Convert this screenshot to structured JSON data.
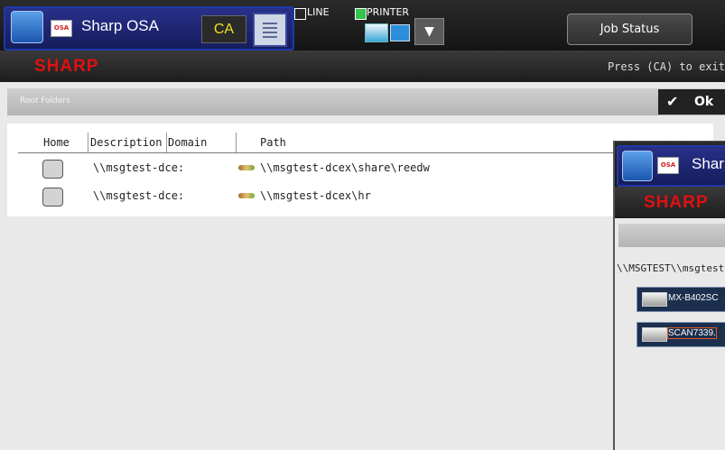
{
  "app": {
    "title": "Sharp OSA",
    "osa_logo_text": "OSA",
    "home_icon": "home-refresh-icon",
    "ca_label": "CA",
    "keypad_icon": "keypad-icon"
  },
  "status": {
    "line_label": "LINE",
    "line_checked": false,
    "printer_label": "PRINTER",
    "printer_checked": true,
    "dropdown_icon": "chevron-down-icon"
  },
  "job_status_label": "Job Status",
  "header": {
    "brand": "SHARP",
    "exit_hint": "Press (CA) to exit"
  },
  "toolbar": {
    "section_label": "Root Folders",
    "ok_label": "Ok",
    "ok_icon": "check-icon"
  },
  "table": {
    "columns": [
      "Home",
      "Description",
      "Domain",
      "Path"
    ],
    "rows": [
      {
        "description": "\\\\msgtest-dce:",
        "domain": "",
        "path": "\\\\msgtest-dcex\\share\\reedw"
      },
      {
        "description": "\\\\msgtest-dce:",
        "domain": "",
        "path": "\\\\msgtest-dcex\\hr"
      }
    ]
  },
  "second_window": {
    "title": "Shar",
    "brand": "SHARP",
    "path": "\\\\MSGTEST\\\\msgtest-",
    "items": [
      {
        "label": "MX-B402SC",
        "selected": false
      },
      {
        "label": "SCAN7339.",
        "selected": true
      }
    ]
  },
  "colors": {
    "brand_red": "#e01010",
    "ca_yellow": "#f0e020",
    "printer_green": "#33c24a"
  }
}
